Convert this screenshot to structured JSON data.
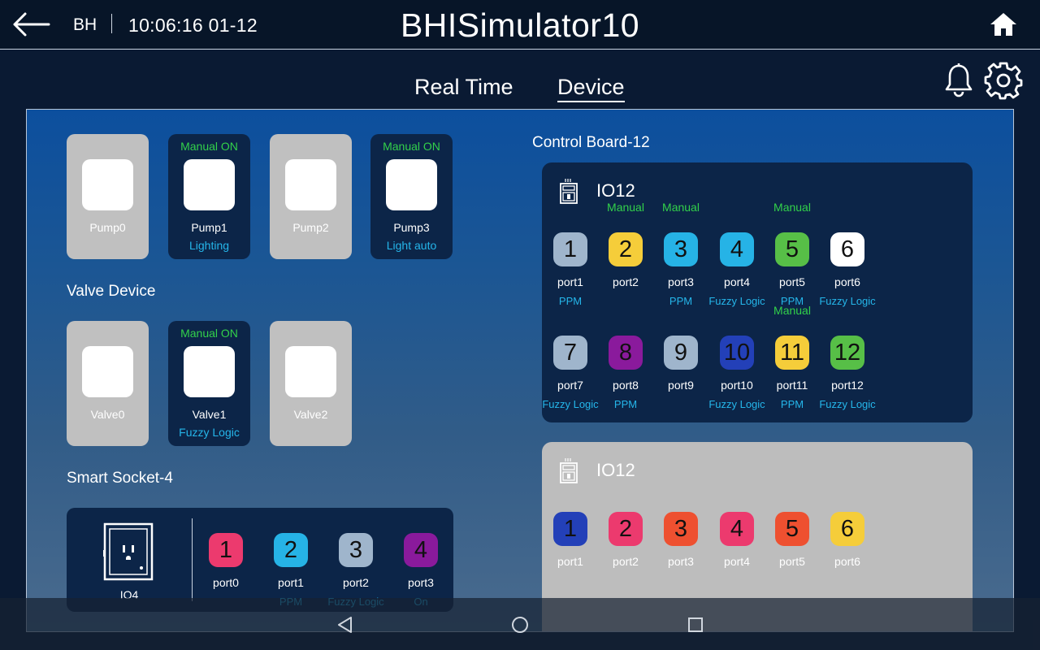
{
  "topbar": {
    "user": "BH",
    "datetime": "10:06:16 01-12",
    "title": "BHISimulator10"
  },
  "tabs": [
    {
      "label": "Real Time",
      "active": false
    },
    {
      "label": "Device",
      "active": true
    }
  ],
  "pumps": [
    {
      "label": "Pump0",
      "state": "",
      "mode": "",
      "on": false
    },
    {
      "label": "Pump1",
      "state": "Manual ON",
      "mode": "Lighting",
      "on": true
    },
    {
      "label": "Pump2",
      "state": "",
      "mode": "",
      "on": false
    },
    {
      "label": "Pump3",
      "state": "Manual ON",
      "mode": "Light auto",
      "on": true
    }
  ],
  "valve_section_title": "Valve Device",
  "valves": [
    {
      "label": "Valve0",
      "state": "",
      "mode": "",
      "on": false
    },
    {
      "label": "Valve1",
      "state": "Manual ON",
      "mode": "Fuzzy Logic",
      "on": true
    },
    {
      "label": "Valve2",
      "state": "",
      "mode": "",
      "on": false
    }
  ],
  "socket_section_title": "Smart Socket-4",
  "socket": {
    "name": "IO4",
    "icon": "power-outlet-icon",
    "ports": [
      {
        "num": "1",
        "name": "port0",
        "mode": "",
        "color": "#ec3a6e"
      },
      {
        "num": "2",
        "name": "port1",
        "mode": "PPM",
        "color": "#26b3e6"
      },
      {
        "num": "3",
        "name": "port2",
        "mode": "Fuzzy Logic",
        "color": "#9fb5cc"
      },
      {
        "num": "4",
        "name": "port3",
        "mode": "On",
        "color": "#8a1a9c"
      }
    ]
  },
  "control_board_title": "Control Board-12",
  "boards": [
    {
      "name": "IO12",
      "icon": "control-board-icon",
      "ports": [
        {
          "num": "1",
          "name": "port1",
          "state": "",
          "mode": "PPM",
          "color": "#9fb5cc"
        },
        {
          "num": "2",
          "name": "port2",
          "state": "Manual",
          "mode": "",
          "color": "#f5cd3a"
        },
        {
          "num": "3",
          "name": "port3",
          "state": "Manual",
          "mode": "PPM",
          "color": "#26b3e6"
        },
        {
          "num": "4",
          "name": "port4",
          "state": "",
          "mode": "Fuzzy Logic",
          "color": "#26b3e6"
        },
        {
          "num": "5",
          "name": "port5",
          "state": "Manual",
          "mode": "PPM",
          "color": "#57bf47"
        },
        {
          "num": "6",
          "name": "port6",
          "state": "",
          "mode": "Fuzzy Logic",
          "color": "#ffffff"
        },
        {
          "num": "7",
          "name": "port7",
          "state": "",
          "mode": "Fuzzy Logic",
          "color": "#9fb5cc"
        },
        {
          "num": "8",
          "name": "port8",
          "state": "",
          "mode": "PPM",
          "color": "#8a1a9c"
        },
        {
          "num": "9",
          "name": "port9",
          "state": "",
          "mode": "",
          "color": "#9fb5cc"
        },
        {
          "num": "10",
          "name": "port10",
          "state": "",
          "mode": "Fuzzy Logic",
          "color": "#2340b8"
        },
        {
          "num": "11",
          "name": "port11",
          "state": "Manual",
          "mode": "PPM",
          "color": "#f5cd3a"
        },
        {
          "num": "12",
          "name": "port12",
          "state": "",
          "mode": "Fuzzy Logic",
          "color": "#57bf47"
        }
      ]
    },
    {
      "name": "IO12",
      "icon": "control-board-icon",
      "ports": [
        {
          "num": "1",
          "name": "port1",
          "state": "",
          "mode": "",
          "color": "#2340b8"
        },
        {
          "num": "2",
          "name": "port2",
          "state": "",
          "mode": "",
          "color": "#ec3a6e"
        },
        {
          "num": "3",
          "name": "port3",
          "state": "",
          "mode": "",
          "color": "#ee5030"
        },
        {
          "num": "4",
          "name": "port4",
          "state": "",
          "mode": "",
          "color": "#ec3a6e"
        },
        {
          "num": "5",
          "name": "port5",
          "state": "",
          "mode": "",
          "color": "#ee5030"
        },
        {
          "num": "6",
          "name": "port6",
          "state": "",
          "mode": "",
          "color": "#f5cd3a"
        }
      ]
    }
  ],
  "navbar": {
    "buttons": [
      "back-nav",
      "home-nav",
      "recents-nav"
    ]
  }
}
